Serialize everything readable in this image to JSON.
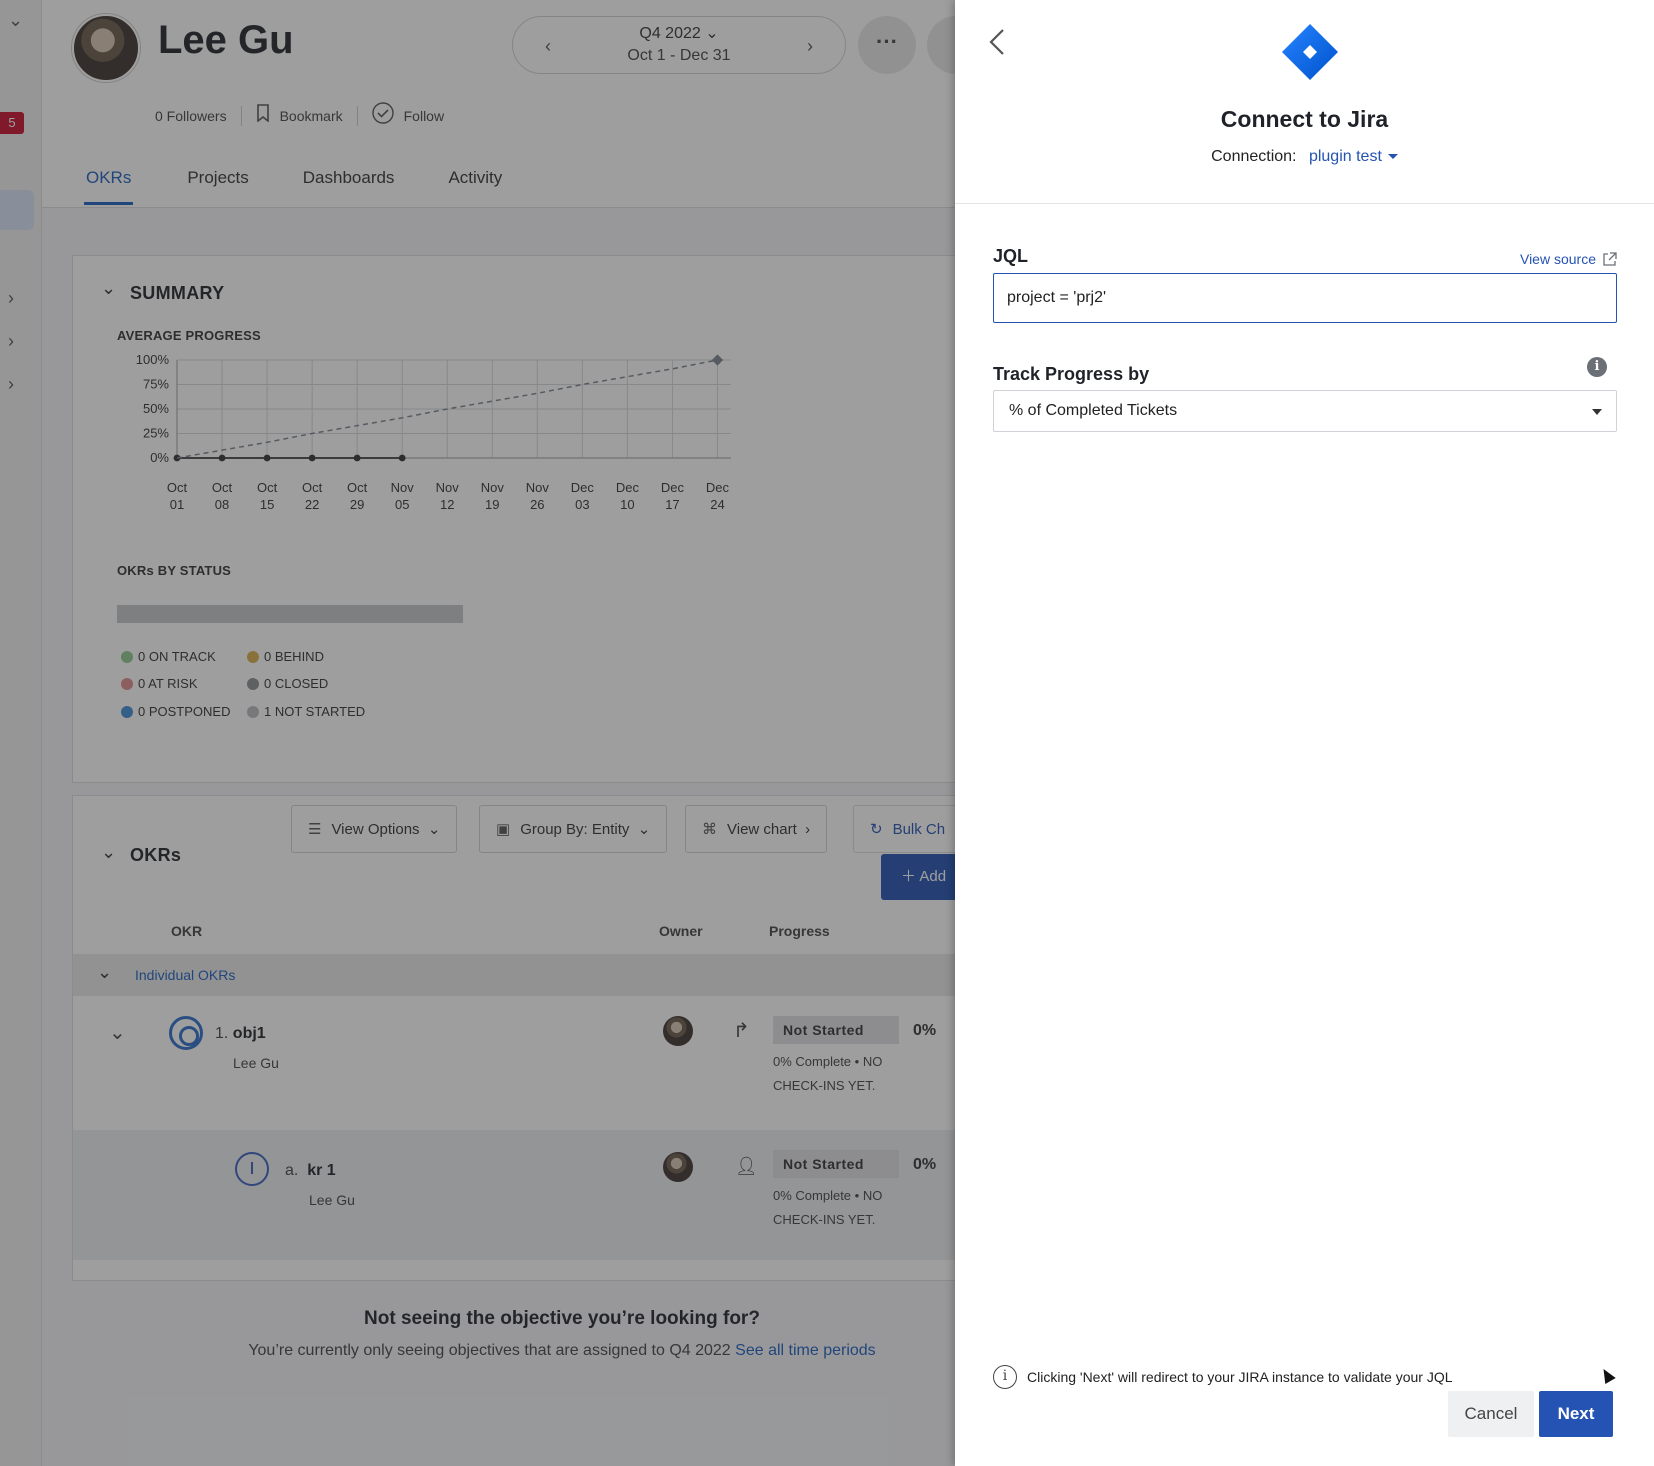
{
  "profile": {
    "name": "Lee Gu",
    "followers": "0 Followers",
    "bookmark_label": "Bookmark",
    "follow_label": "Follow"
  },
  "leftrail": {
    "badge": "5"
  },
  "period": {
    "quarter": "Q4 2022",
    "range": "Oct 1 - Dec 31"
  },
  "tabs": [
    {
      "label": "OKRs",
      "active": true
    },
    {
      "label": "Projects"
    },
    {
      "label": "Dashboards"
    },
    {
      "label": "Activity"
    }
  ],
  "summary": {
    "title": "SUMMARY",
    "avg_progress_label": "AVERAGE PROGRESS",
    "okrs_by_status_label": "OKRs BY STATUS",
    "legend": [
      {
        "label": "0 ON TRACK",
        "color": "#8fc98f"
      },
      {
        "label": "0 BEHIND",
        "color": "#d9b04a"
      },
      {
        "label": "0 AT RISK",
        "color": "#e08a8a"
      },
      {
        "label": "0 CLOSED",
        "color": "#8d8f93"
      },
      {
        "label": "0 POSTPONED",
        "color": "#3f8fd6"
      },
      {
        "label": "1 NOT STARTED",
        "color": "#b9bbbe"
      }
    ]
  },
  "chart_data": {
    "type": "line",
    "title": "AVERAGE PROGRESS",
    "xlabel": "",
    "ylabel": "",
    "ylim": [
      0,
      100
    ],
    "y_ticks": [
      "0%",
      "25%",
      "50%",
      "75%",
      "100%"
    ],
    "x": [
      "Oct 01",
      "Oct 08",
      "Oct 15",
      "Oct 22",
      "Oct 29",
      "Nov 05",
      "Nov 12",
      "Nov 19",
      "Nov 26",
      "Dec 03",
      "Dec 10",
      "Dec 17",
      "Dec 24"
    ],
    "series": [
      {
        "values": [
          0,
          0,
          0,
          0,
          0,
          0
        ],
        "style": "solid",
        "color": "#333333"
      },
      {
        "values": [
          0,
          8,
          16,
          25,
          33,
          41,
          50,
          58,
          66,
          75,
          83,
          91,
          100
        ],
        "style": "dashed",
        "color": "#7d8590"
      }
    ],
    "grid": true
  },
  "okrs": {
    "title": "OKRs",
    "view_options": "View Options",
    "group_by": "Group By: Entity",
    "view_chart": "View chart",
    "bulk": "Bulk Ch",
    "add": "Add",
    "columns": {
      "okr": "OKR",
      "owner": "Owner",
      "progress": "Progress"
    },
    "group": "Individual OKRs",
    "rows": [
      {
        "index": "1.",
        "title": "obj1",
        "owner": "Lee Gu",
        "status": "Not Started",
        "pct": "0%",
        "sub": "0% Complete • NO CHECK-INS YET."
      },
      {
        "index": "a.",
        "title": "kr 1",
        "owner": "Lee Gu",
        "status": "Not Started",
        "pct": "0%",
        "sub": "0% Complete • NO CHECK-INS YET."
      }
    ]
  },
  "footer": {
    "heading": "Not seeing the objective you’re looking for?",
    "text": "You’re currently only seeing objectives that are assigned to Q4 2022",
    "link": "See all time periods"
  },
  "drawer": {
    "title": "Connect to Jira",
    "connection_label": "Connection:",
    "connection_value": "plugin test",
    "jql_label": "JQL",
    "view_source": "View source",
    "jql_value": "project = 'prj2'",
    "track_label": "Track Progress by",
    "track_value": "% of Completed Tickets",
    "note": "Clicking 'Next' will redirect to your JIRA instance to validate your JQL",
    "cancel": "Cancel",
    "next": "Next",
    "brand_color": "#2453b3"
  }
}
